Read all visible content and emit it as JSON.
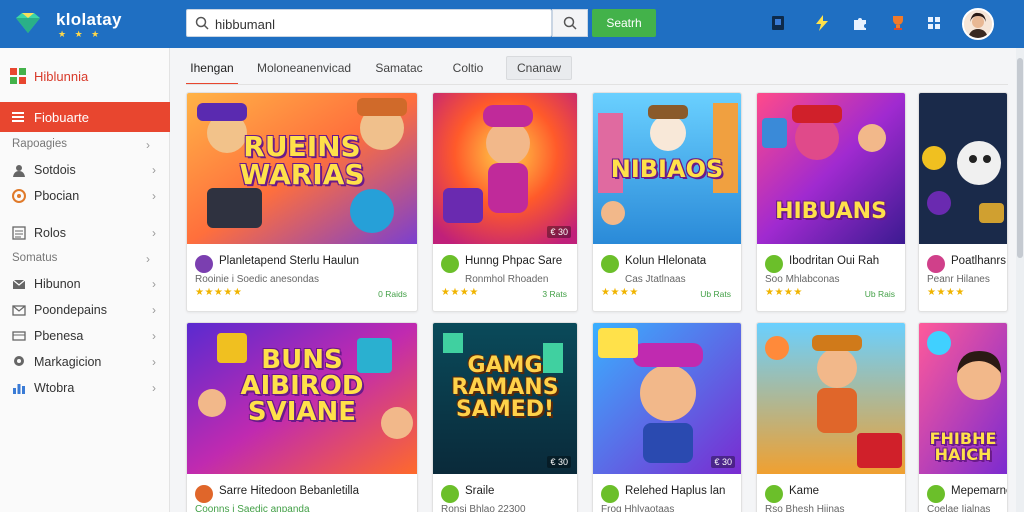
{
  "header": {
    "brand": "klolatay",
    "brand_stars": "★ ★ ★",
    "search_value": "hibbumanl",
    "search_button": "Seatrh"
  },
  "sidebar": {
    "brand_label": "Hiblunnia",
    "active_item": "Fiobuarte",
    "items": [
      {
        "label": "Rapoagies",
        "kind": "section",
        "icon": "none"
      },
      {
        "label": "Sotdois",
        "kind": "item",
        "icon": "user-icon"
      },
      {
        "label": "Pbocian",
        "kind": "item",
        "icon": "circle-icon"
      },
      {
        "label": "Rolos",
        "kind": "item",
        "icon": "list-icon"
      },
      {
        "label": "Somatus",
        "kind": "section",
        "icon": "none"
      },
      {
        "label": "Hibunon",
        "kind": "item",
        "icon": "mail-icon"
      },
      {
        "label": "Poondepains",
        "kind": "item",
        "icon": "envelope-icon"
      },
      {
        "label": "Pbenesa",
        "kind": "item",
        "icon": "card-icon"
      },
      {
        "label": "Markagicion",
        "kind": "item",
        "icon": "pin-icon"
      },
      {
        "label": "Wtobra",
        "kind": "item",
        "icon": "chart-icon"
      }
    ]
  },
  "tabs": [
    "Ihengan",
    "Moloneanenvicad",
    "Samatac",
    "Coltio",
    "Cnanaw"
  ],
  "cards": [
    {
      "art_title": "RUEINS\nWARIAS",
      "name": "Planletapend Sterlu Haulun",
      "sub": "Rooinie i Soedic anesondas",
      "stars": "★★★★★",
      "badge": "0 Raids",
      "price": "",
      "icon_color": "#7b3fb0"
    },
    {
      "art_title": "",
      "name": "Hunng Phpac Sare",
      "sub": "Ronmhol Rhoaden",
      "stars": "★★★★",
      "badge": "3 Rats",
      "price": "€ 30",
      "icon_color": "#6bbf2a"
    },
    {
      "art_title": "NIBIAOS",
      "name": "Kolun Hlelonata",
      "sub": "Cas Jtatlnaas",
      "stars": "★★★★",
      "badge": "Ub Rats",
      "price": "",
      "icon_color": "#6bbf2a"
    },
    {
      "art_title": "HIBUANS",
      "name": "Ibodritan Oui Rah",
      "sub": "Soo Mhlabconas",
      "stars": "★★★★",
      "badge": "Ub Rais",
      "price": "",
      "icon_color": "#6bbf2a"
    },
    {
      "art_title": "",
      "name": "Poatlhanrs",
      "sub": "Peanr Hilanes",
      "stars": "★★★★",
      "badge": "",
      "price": "",
      "icon_color": "#d0408a"
    },
    {
      "art_title": "BUNS\nAIBIROD\nSVIANE",
      "name": "Sarre Hitedoon Bebanletilla",
      "sub": "Coonns i Saedic anpanda",
      "stars": "",
      "badge": "",
      "price": "",
      "icon_color": "#e0662a"
    },
    {
      "art_title": "GAMG\nRAMANS\nSAMED!",
      "name": "Sraile",
      "sub": "Ronsi Bhlao 22300",
      "stars": "",
      "badge": "",
      "price": "€ 30",
      "icon_color": "#6bbf2a"
    },
    {
      "art_title": "",
      "name": "Relehed Haplus lan",
      "sub": "Frog Hhlyaotaas",
      "stars": "",
      "badge": "",
      "price": "€ 30",
      "icon_color": "#6bbf2a"
    },
    {
      "art_title": "",
      "name": "Kame",
      "sub": "Rso Bhesh Hiinas",
      "stars": "",
      "badge": "",
      "price": "",
      "icon_color": "#6bbf2a"
    },
    {
      "art_title": "FHIBHE\nHAICH",
      "name": "Mepemarne",
      "sub": "Coelae Iialnas",
      "stars": "",
      "badge": "",
      "price": "",
      "icon_color": "#6bbf2a"
    }
  ]
}
